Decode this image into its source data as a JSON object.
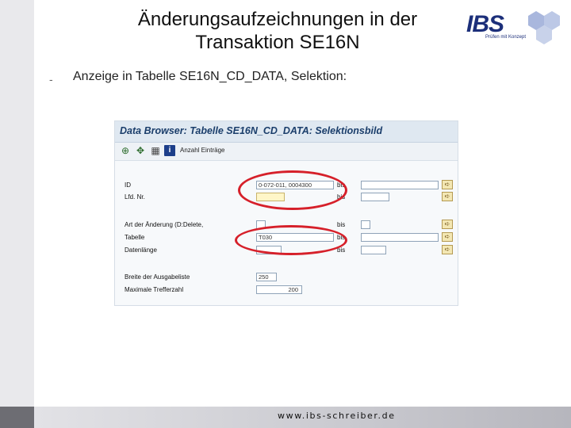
{
  "slide": {
    "title_line1": "Änderungsaufzeichnungen in der",
    "title_line2": "Transaktion SE16N",
    "bullet_marker": "-",
    "bullet_text": "Anzeige in Tabelle SE16N_CD_DATA, Selektion:",
    "footer": "www.ibs-schreiber.de"
  },
  "logo": {
    "text": "IBS",
    "tagline": "Prüfen mit Konzept",
    "brand_color": "#1c2f7a",
    "hex_color": "#a9b7dd"
  },
  "sap_window": {
    "title": "Data Browser: Tabelle SE16N_CD_DATA: Selektionsbild",
    "toolbar": {
      "icons": [
        "execute-icon",
        "selection-options-icon",
        "save-variant-icon",
        "info-icon"
      ],
      "info_glyph": "i",
      "count_label": "Anzahl Einträge"
    },
    "bis_label": "bis",
    "fields": [
      {
        "label": "ID",
        "from_value": "0-072-011, 0004300",
        "to_value": ""
      },
      {
        "label": "Lfd. Nr.",
        "from_value": "",
        "to_value": ""
      },
      {
        "label": "Art der Änderung (D:Delete,",
        "from_value": "",
        "to_value": ""
      },
      {
        "label": "Tabelle",
        "from_value": "T030",
        "to_value": ""
      },
      {
        "label": "Datenlänge",
        "from_value": "",
        "to_value": ""
      }
    ],
    "settings": [
      {
        "label": "Breite der Ausgabeliste",
        "value": "250"
      },
      {
        "label": "Maximale Trefferzahl",
        "value": "200"
      }
    ],
    "highlight_color": "#d6202a"
  }
}
